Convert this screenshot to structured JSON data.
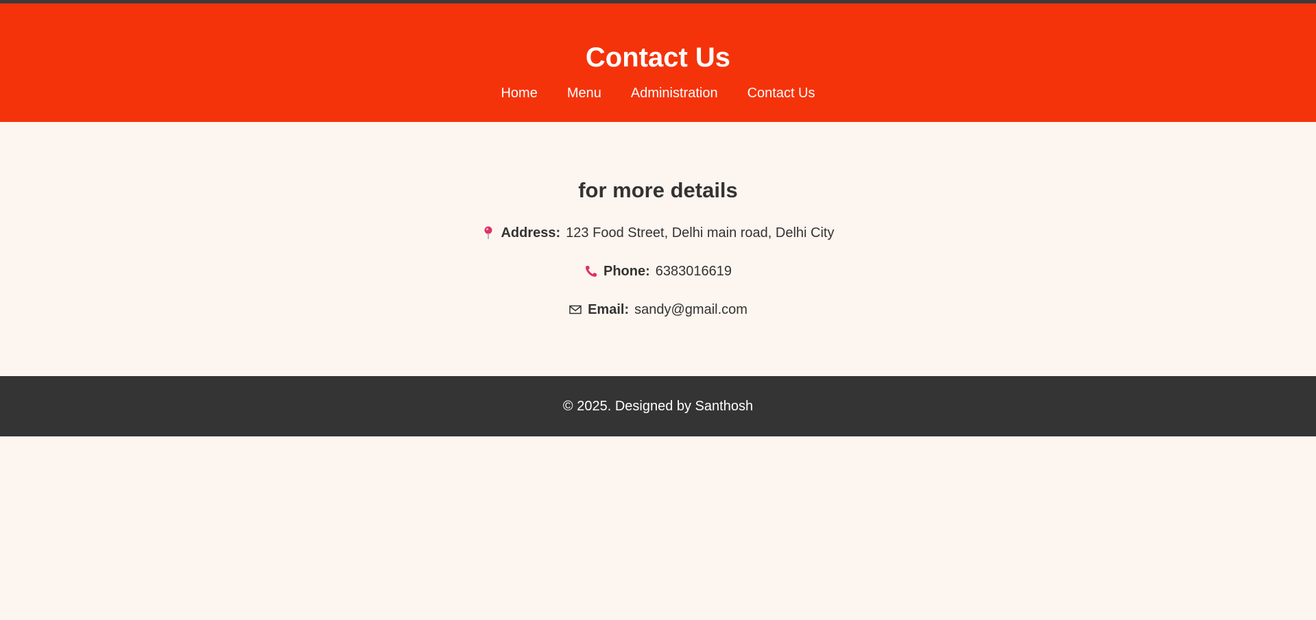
{
  "header": {
    "title": "Contact Us",
    "nav": [
      {
        "label": "Home"
      },
      {
        "label": "Menu"
      },
      {
        "label": "Administration"
      },
      {
        "label": "Contact Us"
      }
    ]
  },
  "main": {
    "heading": "for more details",
    "contacts": [
      {
        "icon": "map-pin-icon",
        "label": "Address:",
        "value": "123 Food Street, Delhi main road, Delhi City"
      },
      {
        "icon": "phone-icon",
        "label": "Phone:",
        "value": "6383016619"
      },
      {
        "icon": "envelope-icon",
        "label": "Email:",
        "value": "sandy@gmail.com"
      }
    ]
  },
  "footer": {
    "text": "© 2025. Designed by Santhosh"
  },
  "colors": {
    "header_bg": "#f5330b",
    "page_bg": "#fdf5ef",
    "footer_bg": "#343434",
    "icon_accent": "#e0306a"
  }
}
